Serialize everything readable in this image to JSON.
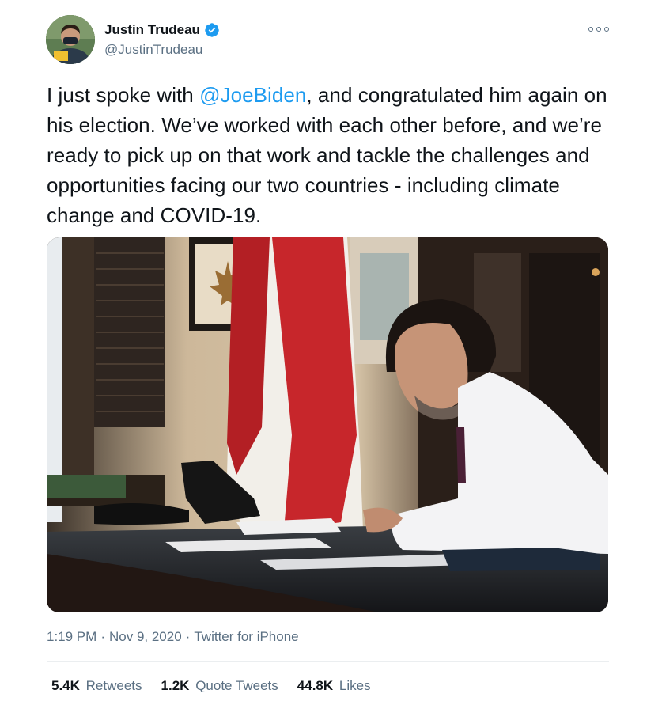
{
  "author": {
    "display_name": "Justin Trudeau",
    "handle": "@JustinTrudeau",
    "verified": true
  },
  "tweet": {
    "text_before_mention": "I just spoke with ",
    "mention": "@JoeBiden",
    "text_after_mention": ", and congratulated him again on his election. We’ve worked with each other before, and we’re ready to pick up on that work and tackle the challenges and opportunities facing our two countries - including climate change and COVID-19."
  },
  "meta": {
    "time": "1:19 PM",
    "separator": "·",
    "date": "Nov 9, 2020",
    "source": "Twitter for iPhone"
  },
  "stats": {
    "retweets_count": "5.4K",
    "retweets_label": "Retweets",
    "quote_count": "1.2K",
    "quote_label": "Quote Tweets",
    "likes_count": "44.8K",
    "likes_label": "Likes"
  },
  "colors": {
    "accent": "#1d9bf0",
    "secondary_text": "#5b7083",
    "primary_text": "#0f1419"
  },
  "icons": {
    "verified": "verified-badge-icon",
    "more": "more-options-icon"
  }
}
